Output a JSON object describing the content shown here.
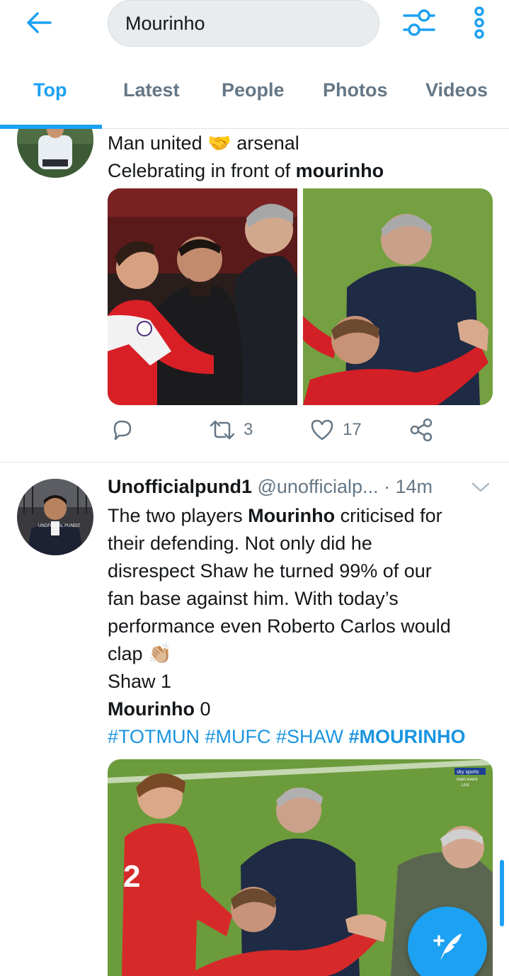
{
  "header": {
    "search_value": "Mourinho",
    "back_icon": "arrow-left-icon",
    "filter_icon": "sliders-icon",
    "more_icon": "more-vertical-icon"
  },
  "tabs": [
    {
      "label": "Top",
      "active": true
    },
    {
      "label": "Latest",
      "active": false
    },
    {
      "label": "People",
      "active": false
    },
    {
      "label": "Photos",
      "active": false
    },
    {
      "label": "Videos",
      "active": false
    }
  ],
  "tweet1": {
    "line1_a": "Man united ",
    "line1_emoji": "🤝",
    "line1_b": " arsenal",
    "line2_a": "Celebrating in front of ",
    "line2_bold": "mourinho",
    "retweets": "3",
    "likes": "17"
  },
  "tweet2": {
    "name": "Unofficialpund1",
    "handle": " @unofficialp...",
    "time": " · 14m",
    "line1_a": "The two players ",
    "line1_bold": "Mourinho",
    "line1_b": " criticised for",
    "line2": "their defending. Not only did he",
    "line3": "disrespect Shaw he turned 99% of our",
    "line4": "fan base against him. With today’s",
    "line5": "performance even Roberto Carlos would",
    "line6_a": "clap ",
    "line6_emoji": "👏🏼",
    "line7": "Shaw 1",
    "line8_bold": "Mourinho",
    "line8_b": " 0",
    "hashtags_a": "#TOTMUN #MUFC #SHAW ",
    "hashtags_bold": "#MOURINHO",
    "avatar_text": "UNOFFICIAL PUNDIT",
    "watermark_top": "sky sports",
    "watermark_bottom": "main event",
    "watermark_live": "LIVE"
  },
  "colors": {
    "accent": "#1da1f2",
    "muted": "#657786",
    "text": "#14171a"
  },
  "fab_icon": "compose-tweet-icon"
}
